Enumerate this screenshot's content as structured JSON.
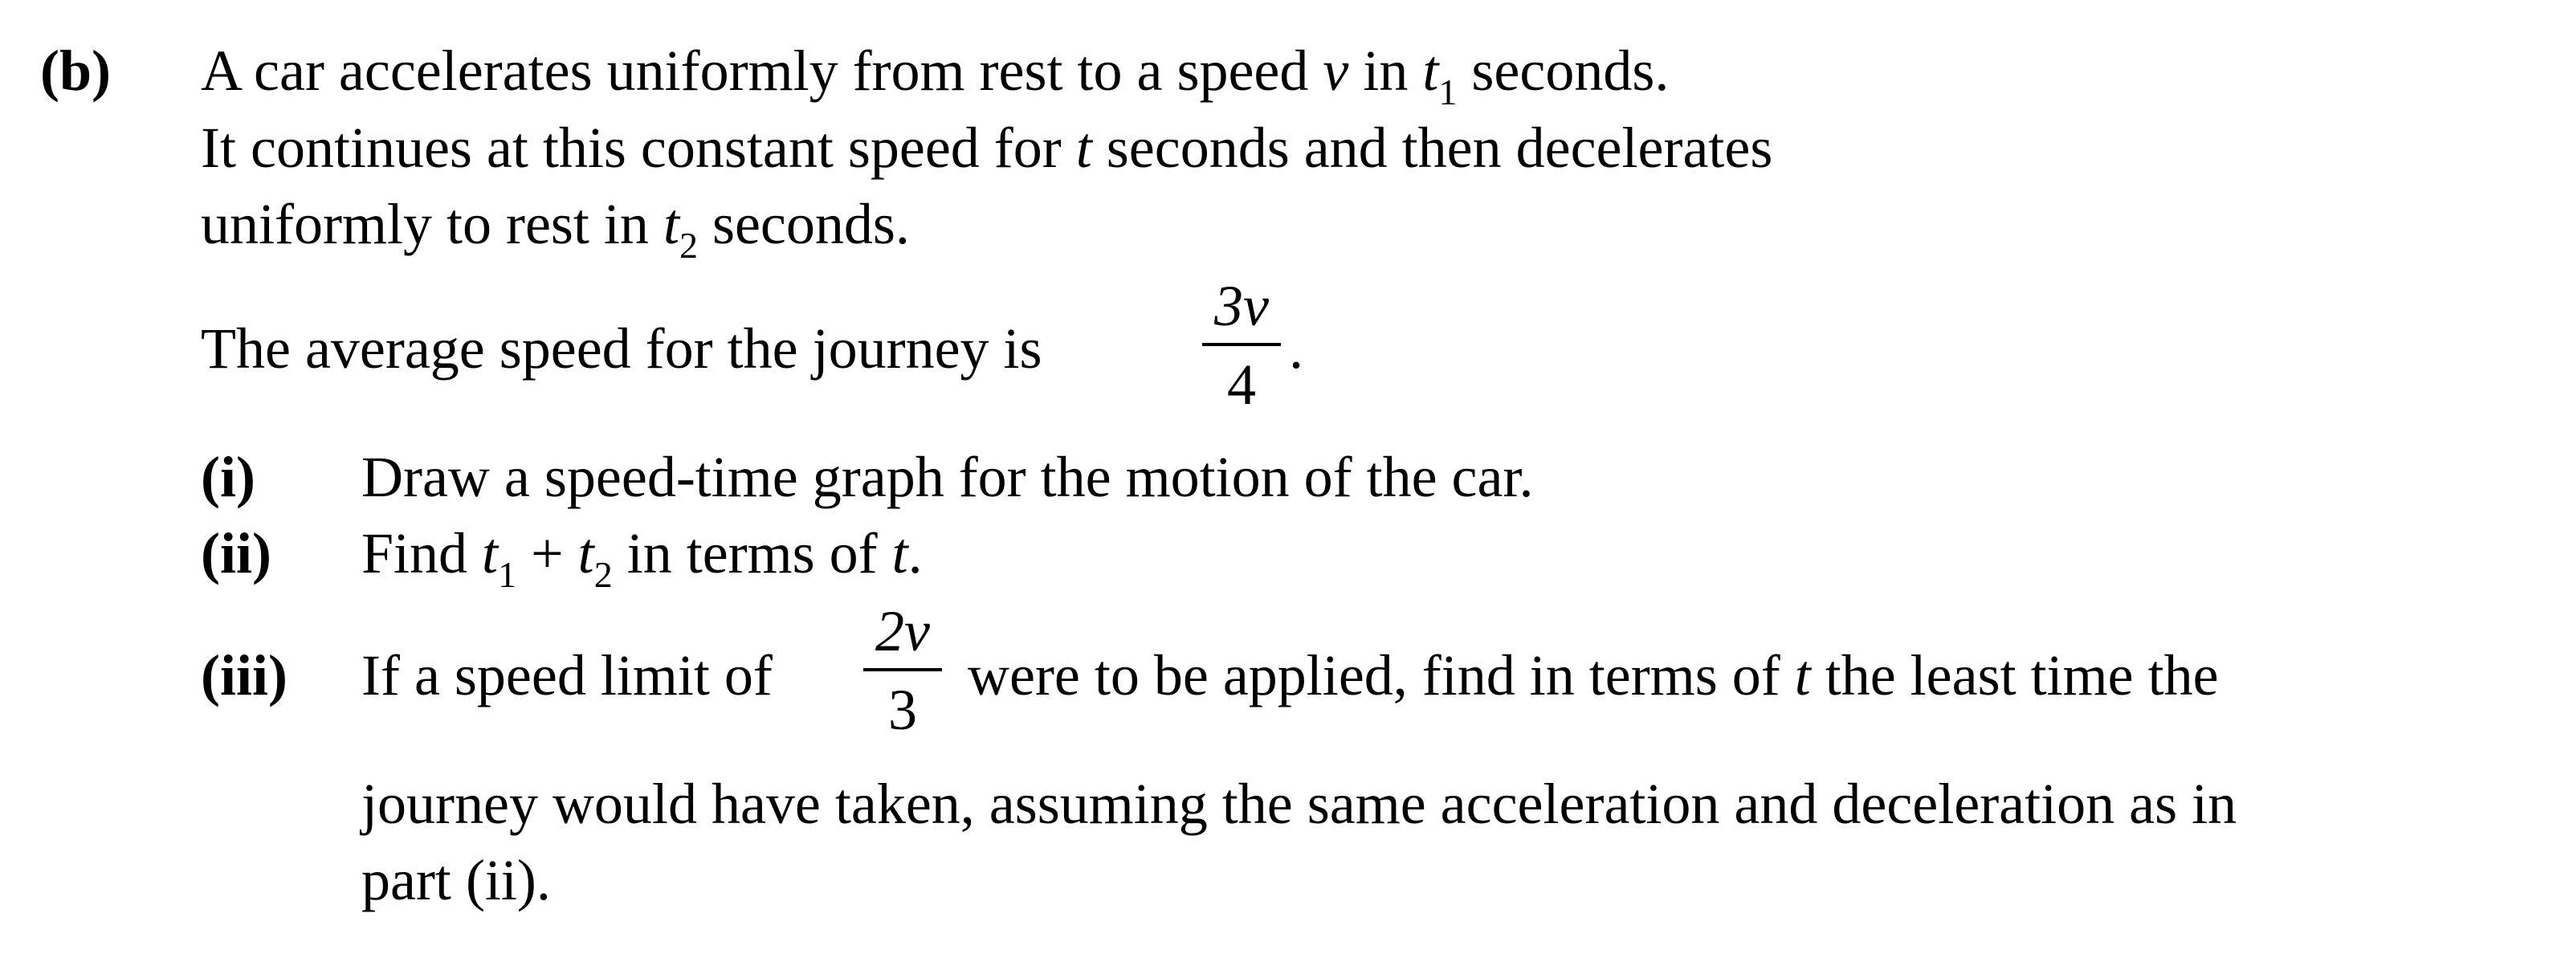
{
  "part_label": "(b)",
  "intro": {
    "line1": {
      "a": "A car accelerates uniformly from rest to a speed ",
      "v": "v",
      "b": " in ",
      "t": "t",
      "sub": "1",
      "c": " seconds."
    },
    "line2": {
      "a": "It continues at this constant speed for ",
      "t": "t",
      "b": " seconds and then decelerates"
    },
    "line3": {
      "a": "uniformly to rest in ",
      "t": "t",
      "sub": "2",
      "b": " seconds."
    },
    "line4": {
      "a": "The average speed for the journey is ",
      "frac_num": "3v",
      "frac_den": "4",
      "end": "."
    }
  },
  "items": [
    {
      "label": "(i)",
      "text": "Draw a speed-time graph for the motion of the car."
    },
    {
      "label": "(ii)",
      "a": "Find ",
      "t1": "t",
      "sub1": "1",
      "plus": " + ",
      "t2": "t",
      "sub2": "2",
      "b": " in terms of ",
      "t": "t",
      "end": "."
    },
    {
      "label": "(iii)",
      "a": "If a speed limit of ",
      "frac_num": "2v",
      "frac_den": "3",
      "b": " were to be applied, find in terms of ",
      "t": "t",
      "c": " the least time the",
      "line2": "journey would have taken, assuming the same acceleration and deceleration as in",
      "line3": "part (ii)."
    }
  ]
}
